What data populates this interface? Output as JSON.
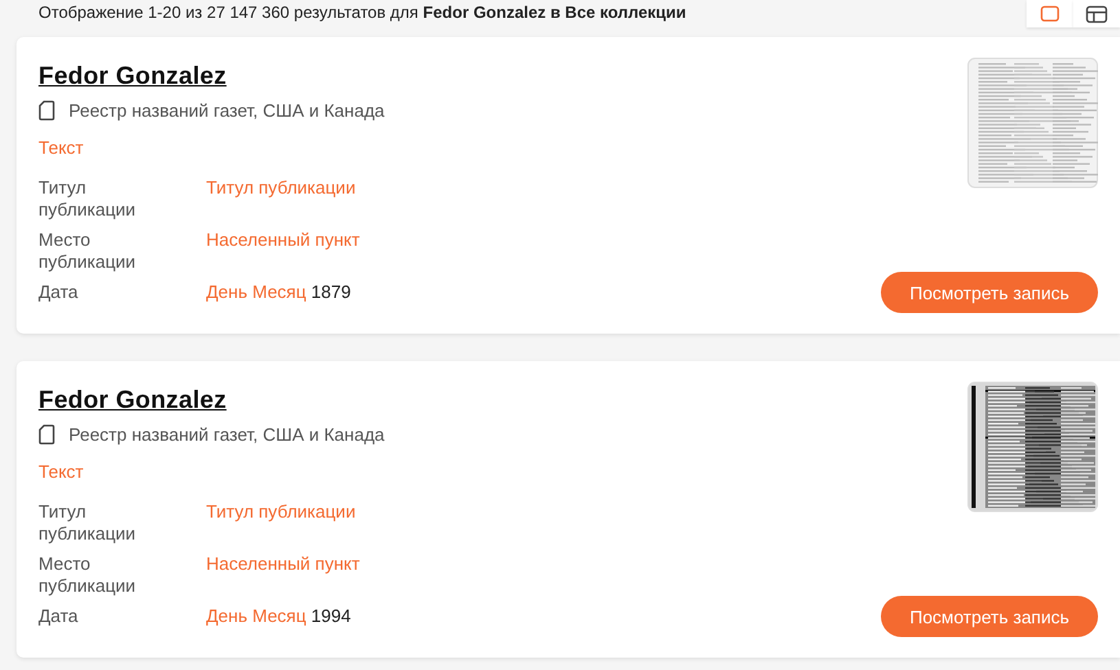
{
  "results_summary": "Отображение 1-20 из 27 147 360 результатов для **Fedor Gonzalez в Все коллекции**",
  "view_toggle": [
    {
      "kind": "list",
      "selected": true
    },
    {
      "kind": "table",
      "selected": false
    }
  ],
  "records": [
    {
      "name": "Fedor Gonzalez",
      "collection": "Реестр названий газет, США и Канада",
      "record_type": "Текст",
      "fields": [
        {
          "label": "Титул публикации",
          "value": "Титул публикации"
        },
        {
          "label": "Место публикации",
          "value": "Населенный пункт"
        },
        {
          "label": "Дата",
          "value": "День Месяц",
          "extra": "1879"
        }
      ],
      "thumbnail": {
        "kind": "light"
      },
      "button": "Посмотреть запись"
    },
    {
      "name": "Fedor Gonzalez",
      "collection": "Реестр названий газет, США и Канада",
      "record_type": "Текст",
      "fields": [
        {
          "label": "Титул публикации",
          "value": "Титул публикации"
        },
        {
          "label": "Место публикации",
          "value": "Населенный пункт"
        },
        {
          "label": "Дата",
          "value": "День Месяц",
          "extra": "1994"
        }
      ],
      "thumbnail": {
        "kind": "dark"
      },
      "button": "Посмотреть запись"
    }
  ]
}
